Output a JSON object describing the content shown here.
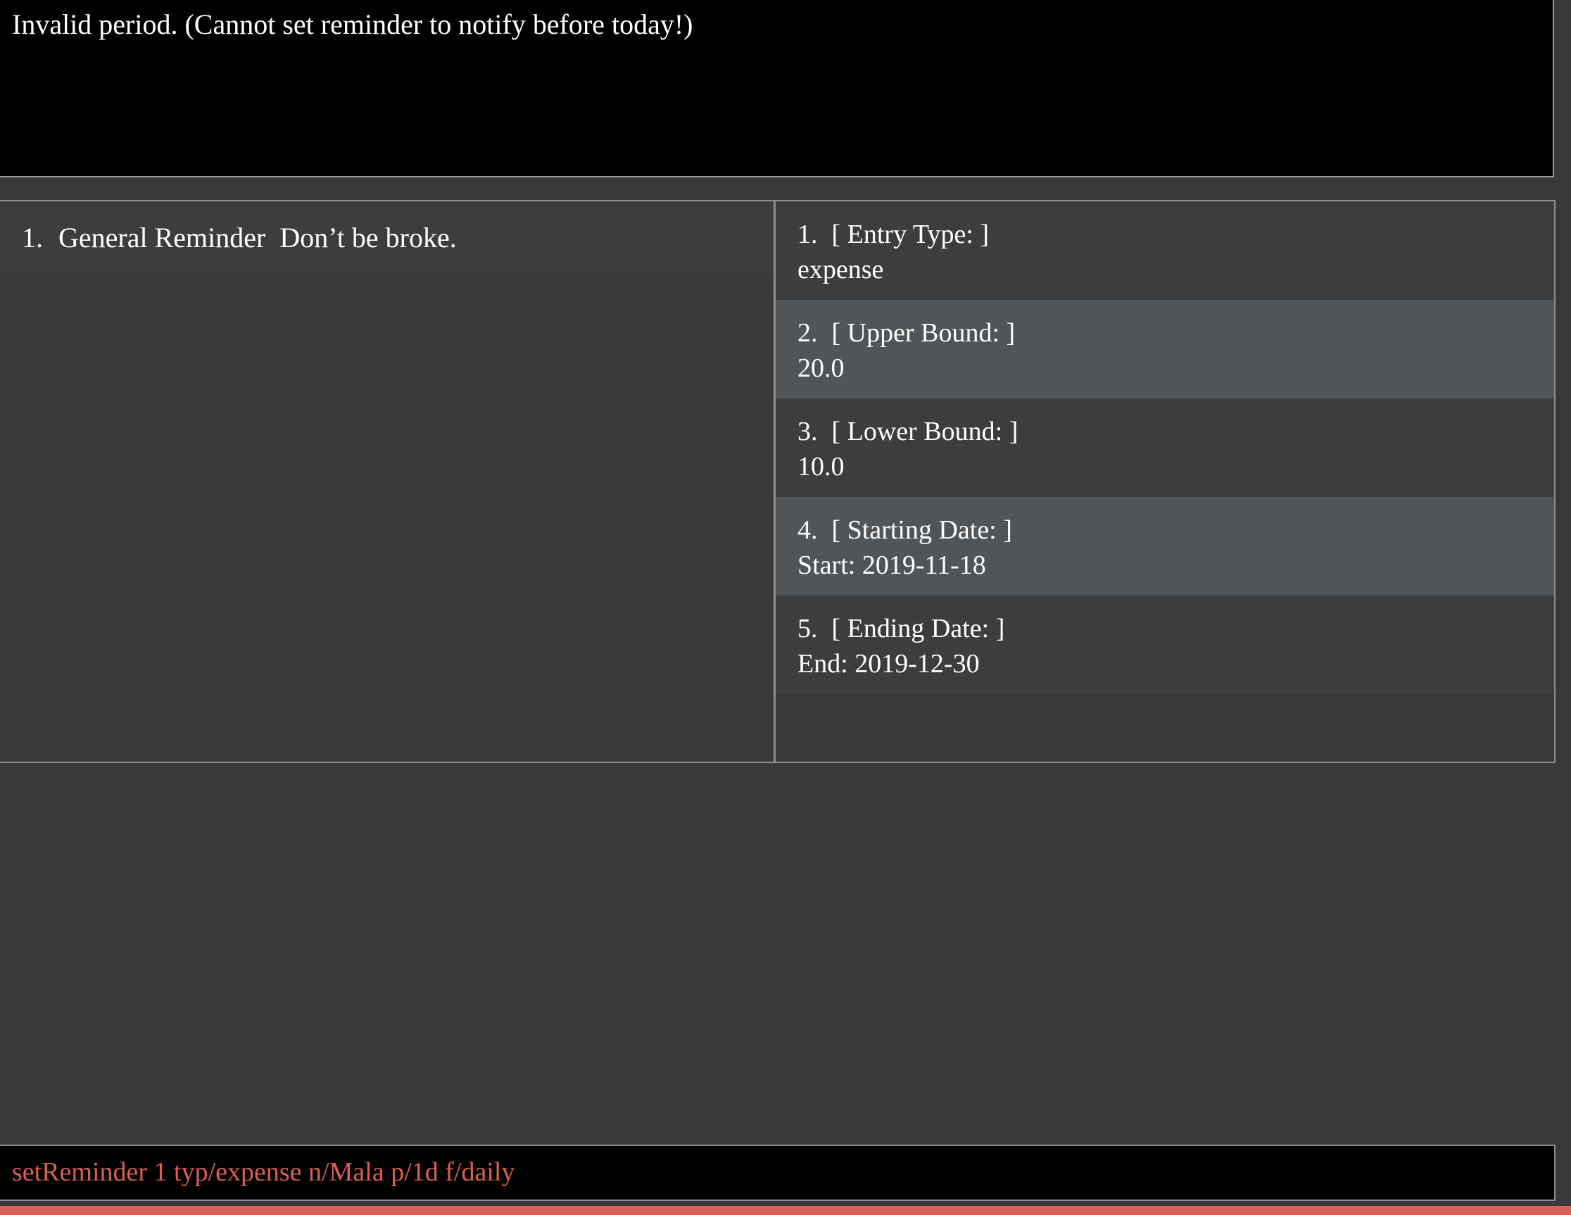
{
  "result_display": {
    "message": "Invalid period. (Cannot set reminder to notify before today!)"
  },
  "reminder_list": {
    "items": [
      {
        "index": "1.",
        "name": "General Reminder",
        "message": "Don’t be broke."
      }
    ]
  },
  "details": {
    "items": [
      {
        "index": "1.",
        "label": "[ Entry Type: ]",
        "value": "expense"
      },
      {
        "index": "2.",
        "label": "[ Upper Bound: ]",
        "value": "20.0"
      },
      {
        "index": "3.",
        "label": "[ Lower Bound: ]",
        "value": "10.0"
      },
      {
        "index": "4.",
        "label": "[ Starting Date: ]",
        "value": "Start: 2019-11-18"
      },
      {
        "index": "5.",
        "label": "[ Ending Date: ]",
        "value": "End: 2019-12-30"
      }
    ]
  },
  "command_box": {
    "value": "setReminder 1 typ/expense n/Mala p/1d f/daily"
  },
  "colors": {
    "background": "#383838",
    "result_background": "#000000",
    "row_dark": "#3c3d3f",
    "row_light": "#515558",
    "command_text": "#d9614f",
    "status_bar": "#d9605a"
  }
}
